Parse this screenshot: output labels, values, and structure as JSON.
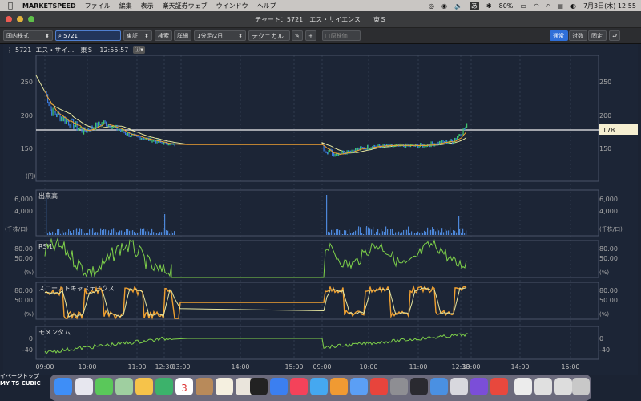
{
  "menubar": {
    "app": "MARKETSPEED",
    "items": [
      "ファイル",
      "編集",
      "表示",
      "楽天証券ウェブ",
      "ウインドウ",
      "ヘルプ"
    ],
    "battery": "80%",
    "datetime": "7月3日(木) 12:55"
  },
  "window": {
    "title": "チャート：5721　エス・サイエンス　　東Ｓ"
  },
  "toolbar": {
    "market": "国内株式",
    "code": "5721",
    "exchange": "東証",
    "search": "検索",
    "detail": "詳細",
    "interval": "1分足/2日",
    "technical": "テクニカル",
    "original_price": "原株価",
    "mode_normal": "通常",
    "mode_log": "対数",
    "mode_fixed": "固定"
  },
  "info": {
    "code": "5721",
    "name": "エス・サイ…",
    "market": "東Ｓ",
    "time": "12:55:57"
  },
  "panels": {
    "price": {
      "yticks": [
        "250",
        "200",
        "150"
      ],
      "unit": "(円)",
      "current": "178"
    },
    "volume": {
      "title": "出来高",
      "yticks": [
        "6,000",
        "4,000"
      ],
      "unit": "(千株/口)"
    },
    "rsi": {
      "title": "RSI1",
      "yticks": [
        "80.00",
        "50.00"
      ],
      "unit": "(%)"
    },
    "stoch": {
      "title": "スローストキャスティクス",
      "yticks": [
        "80.00",
        "50.00"
      ],
      "unit": "(%)"
    },
    "momentum": {
      "title": "モメンタム",
      "yticks": [
        "0",
        "-40"
      ]
    }
  },
  "xaxis": [
    "09:00",
    "10:00",
    "11:00",
    "12:30",
    "13:00",
    "14:00",
    "15:00",
    "09:00",
    "10:00",
    "11:00",
    "12:30",
    "13:00",
    "14:00",
    "15:00"
  ],
  "desktop": {
    "label1": "イページトップ",
    "label2": "MY TS CUBIC"
  },
  "dock": {
    "calendar_day": "3"
  },
  "colors": {
    "up": "#3ec46d",
    "down": "#3a7be0",
    "ma1": "#f0a030",
    "ma2": "#e6e6a0",
    "line_green": "#7fd34a"
  }
}
